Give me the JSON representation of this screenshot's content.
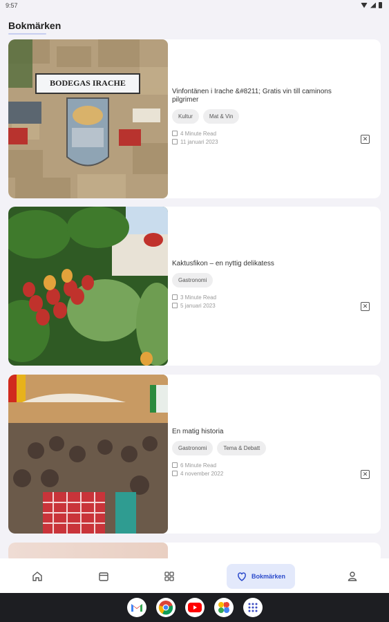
{
  "status": {
    "time": "9:57"
  },
  "page": {
    "title": "Bokmärken"
  },
  "cards": [
    {
      "title": "Vinfontänen i Irache &#8211; Gratis vin till caminons pilgrimer",
      "tags": [
        "Kultur",
        "Mat & Vin"
      ],
      "read_time": "4 Minute Read",
      "date": "11 januari 2023",
      "image": "Bodegas Irache wine fountain",
      "image_sign": "BODEGAS IRACHE"
    },
    {
      "title": "Kaktusfikon – en nyttig delikatess",
      "tags": [
        "Gastronomi"
      ],
      "read_time": "3 Minute Read",
      "date": "5 januari 2023",
      "image": "Prickly pear cactus fruits"
    },
    {
      "title": "En matig historia",
      "tags": [
        "Gastronomi",
        "Tema & Debatt"
      ],
      "read_time": "6 Minute Read",
      "date": "4 november 2022",
      "image": "Crowded outdoor dinner street in Italy"
    }
  ],
  "nav": {
    "items": [
      "home-icon",
      "calendar-icon",
      "grid-icon",
      "bookmarks-icon",
      "profile-icon"
    ],
    "active_label": "Bokmärken"
  },
  "dock": [
    "gmail-icon",
    "chrome-icon",
    "youtube-icon",
    "photos-icon",
    "apps-icon"
  ],
  "colors": {
    "accent": "#2b4acb",
    "active_bg": "#e3e9fb"
  }
}
